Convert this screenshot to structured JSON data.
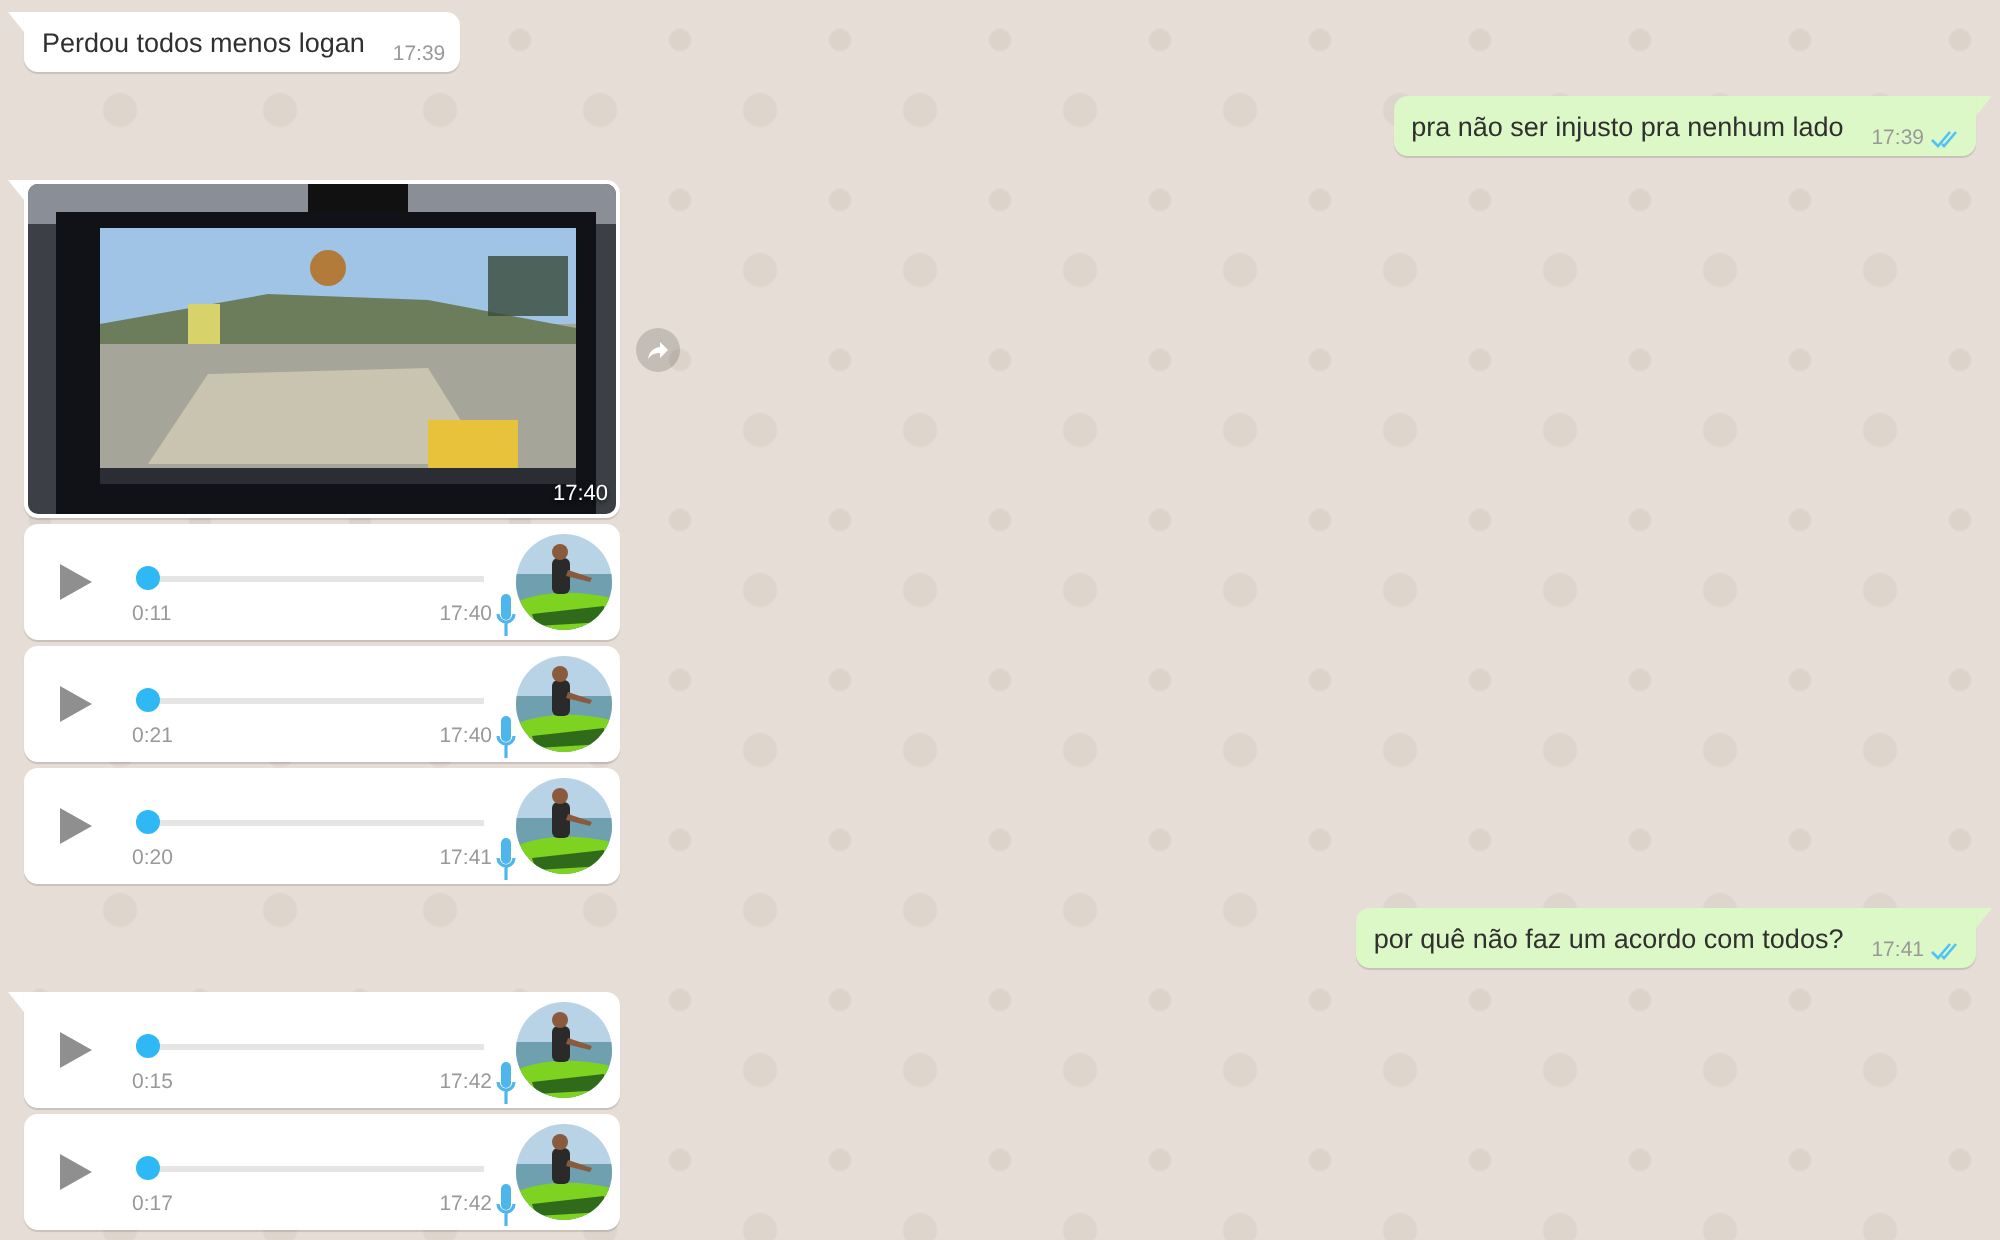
{
  "messages": [
    {
      "kind": "text",
      "outgoing": false,
      "tail": true,
      "text": "Perdou todos menos logan",
      "time": "17:39"
    },
    {
      "kind": "text",
      "outgoing": true,
      "tail": true,
      "text": "pra não ser injusto pra nenhum lado",
      "time": "17:39",
      "read": true
    },
    {
      "outgoing": false,
      "tail": true,
      "time": "17:40",
      "forward": true
    },
    {
      "kind": "voice",
      "outgoing": false,
      "tail": false,
      "duration": "0:11",
      "time": "17:40",
      "level": 0
    },
    {
      "kind": "voice",
      "outgoing": false,
      "tail": false,
      "duration": "0:21",
      "time": "17:40",
      "level": 0
    },
    {
      "kind": "voice",
      "outgoing": false,
      "tail": false,
      "duration": "0:20",
      "time": "17:41",
      "level": 0
    },
    {
      "kind": "text",
      "outgoing": true,
      "tail": true,
      "text": "por quê não faz um acordo com todos?",
      "time": "17:41",
      "read": true
    },
    {
      "kind": "voice",
      "outgoing": false,
      "tail": true,
      "duration": "0:15",
      "time": "17:42",
      "level": 0
    },
    {
      "kind": "voice",
      "outgoing": false,
      "tail": false,
      "duration": "0:17",
      "time": "17:42",
      "level": 0
    }
  ]
}
